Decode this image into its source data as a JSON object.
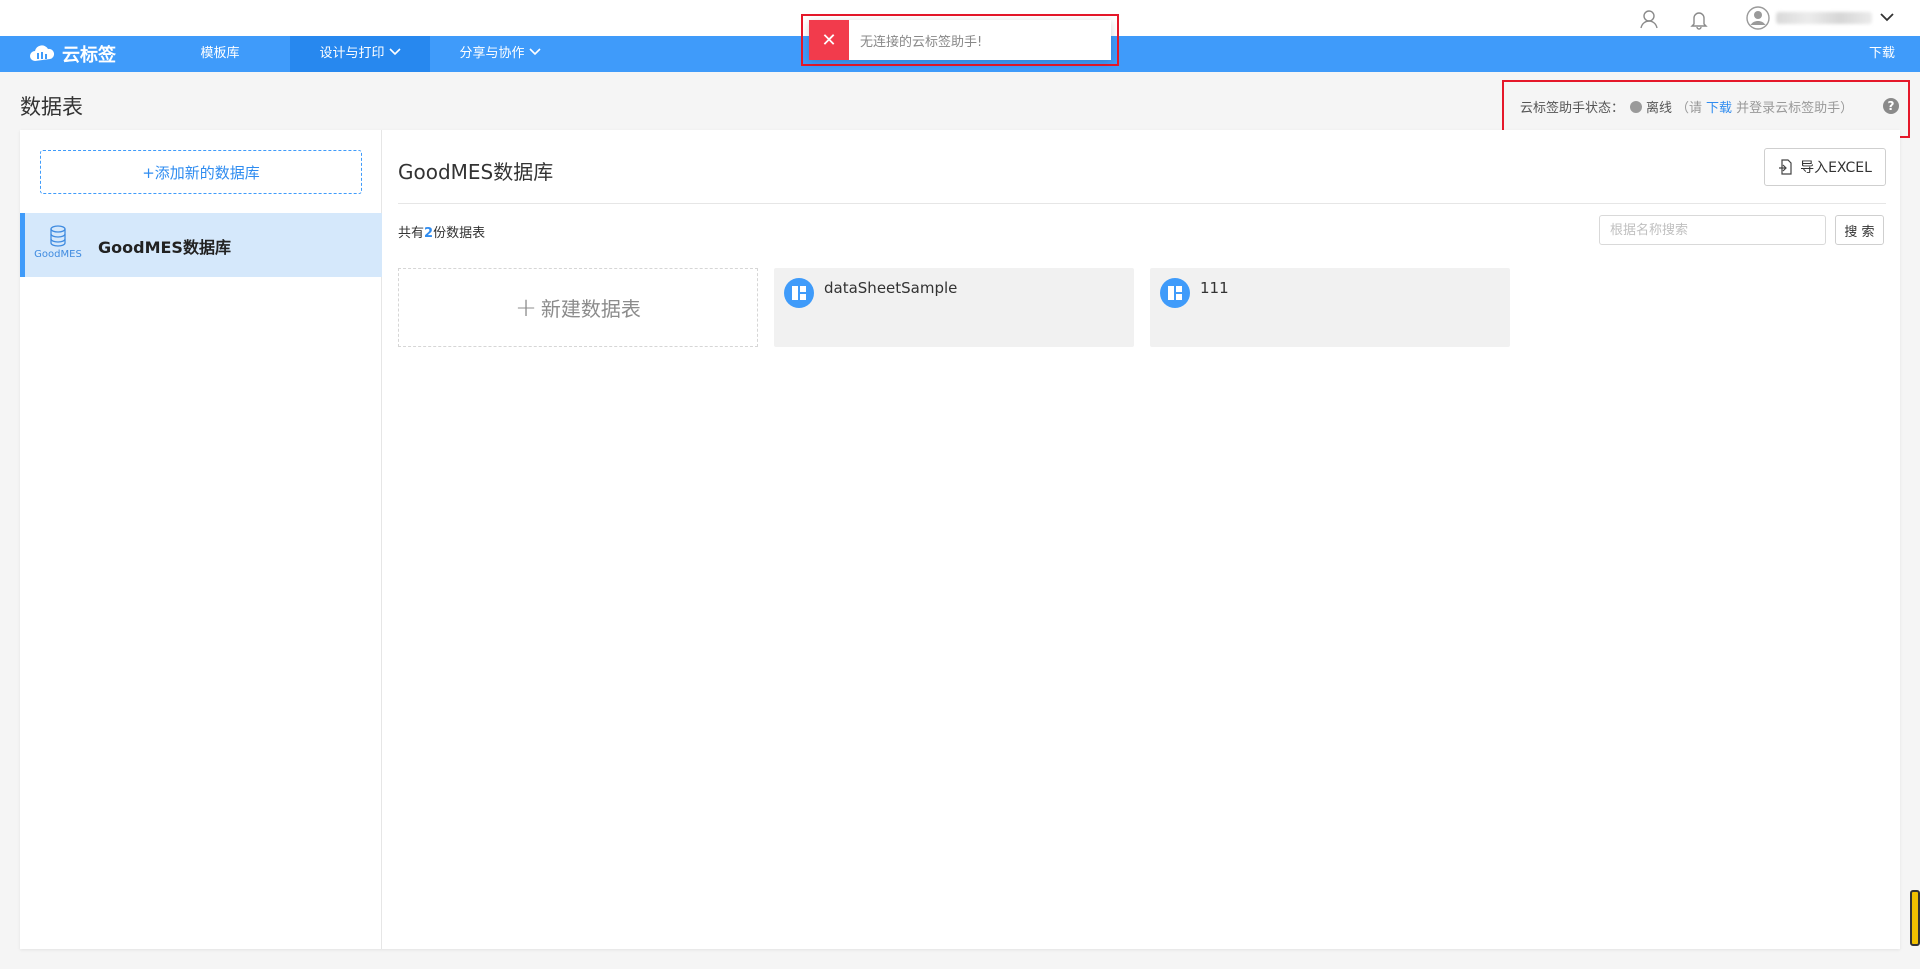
{
  "app": {
    "name": "云标签"
  },
  "topbar": {
    "user_icon": "contacts-icon",
    "bell_icon": "bell-icon",
    "avatar_icon": "user-avatar-icon",
    "dropdown_icon": "chevron-down-icon"
  },
  "nav": {
    "items": [
      {
        "label": "模板库"
      },
      {
        "label": "设计与打印"
      },
      {
        "label": "分享与协作"
      }
    ],
    "download": "下载"
  },
  "toast": {
    "icon": "close-icon",
    "message": "无连接的云标签助手!",
    "color": "#f23b4c"
  },
  "page": {
    "title": "数据表"
  },
  "helper_status": {
    "label": "云标签助手状态：",
    "state": "离线",
    "hint_prefix": "（请",
    "hint_link": "下载",
    "hint_suffix": "并登录云标签助手）",
    "help_icon": "question-icon"
  },
  "sidebar": {
    "add_button": "+添加新的数据库",
    "databases": [
      {
        "icon_label": "GoodMES",
        "name": "GoodMES数据库",
        "selected": true
      }
    ]
  },
  "main": {
    "title": "GoodMES数据库",
    "import_button": "导入EXCEL",
    "count_prefix": "共有",
    "count": "2",
    "count_suffix": "份数据表",
    "search_placeholder": "根据名称搜索",
    "search_button": "搜 索",
    "new_sheet": "新建数据表",
    "sheets": [
      {
        "name": "dataSheetSample"
      },
      {
        "name": "111"
      }
    ]
  },
  "colors": {
    "brand": "#3f9bfa",
    "link": "#2f8cf0",
    "alert": "#e5182a"
  }
}
